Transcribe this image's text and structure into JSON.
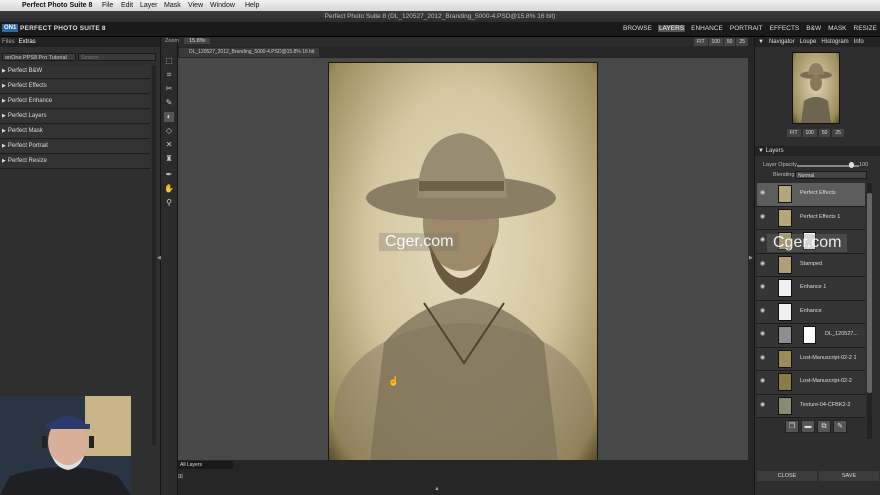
{
  "menubar": {
    "app_name": "Perfect Photo Suite 8",
    "items": [
      "File",
      "Edit",
      "Layer",
      "Mask",
      "View",
      "Window",
      "Help"
    ]
  },
  "window": {
    "title": "Perfect Photo Suite 8 (DL_120527_2012_Branding_5000-4.PSD@15.8% 16 bit)"
  },
  "app": {
    "logo": "ON1",
    "title": "PERFECT PHOTO SUITE 8",
    "modules": [
      "BROWSE",
      "LAYERS",
      "ENHANCE",
      "PORTRAIT",
      "EFFECTS",
      "B&W",
      "MASK",
      "RESIZE"
    ],
    "active_module": "LAYERS"
  },
  "left_panel": {
    "tabs": [
      "Files",
      "Extras"
    ],
    "active_tab": "Extras",
    "library": "onOne PPS8 Pro Tutorial",
    "search_placeholder": "Search",
    "folders": [
      "Perfect B&W",
      "Perfect Effects",
      "Perfect Enhance",
      "Perfect Layers",
      "Perfect Mask",
      "Perfect Portrait",
      "Perfect Resize"
    ]
  },
  "document": {
    "zoom_label": "Zoom",
    "zoom_value": "15.8%",
    "tab_name": "DL_120527_2012_Branding_5000-4.PSD@15.8% 16 bit",
    "view_buttons": [
      "FIT",
      "100",
      "50",
      "25"
    ]
  },
  "canvas_bottom": {
    "layer_set": "All Layers"
  },
  "right_panel": {
    "tabs": [
      "Navigator",
      "Loupe",
      "Histogram",
      "Info"
    ],
    "nav_buttons": [
      "FIT",
      "100",
      "50",
      "25"
    ],
    "layers_header": "Layers",
    "opacity_label": "Layer Opacity",
    "opacity_value": "100",
    "blending_label": "Blending",
    "blending_value": "Normal",
    "layers": [
      {
        "name": "Perfect Effects",
        "selected": true,
        "has_mask": false
      },
      {
        "name": "Perfect Effects 1",
        "selected": false,
        "has_mask": false
      },
      {
        "name": "",
        "selected": false,
        "has_mask": true
      },
      {
        "name": "Stamped",
        "selected": false,
        "has_mask": false
      },
      {
        "name": "Enhance 1",
        "selected": false,
        "has_mask": false
      },
      {
        "name": "Enhance",
        "selected": false,
        "has_mask": false
      },
      {
        "name": "DL_120527...",
        "selected": false,
        "has_mask": true
      },
      {
        "name": "Lost-Manuscript-02-2 1",
        "selected": false,
        "has_mask": false
      },
      {
        "name": "Lost-Manuscript-02-2",
        "selected": false,
        "has_mask": false
      },
      {
        "name": "Texture-04-CFBK2-2",
        "selected": false,
        "has_mask": false
      }
    ],
    "close_label": "CLOSE",
    "save_label": "SAVE"
  },
  "watermark": "Cger.com",
  "colors": {
    "accent": "#2a6aa8",
    "selected_layer": "#5d5d5d",
    "panel_bg": "#2f2f2f",
    "canvas_bg": "#484848",
    "photo_tone": "#d4c7a0"
  }
}
